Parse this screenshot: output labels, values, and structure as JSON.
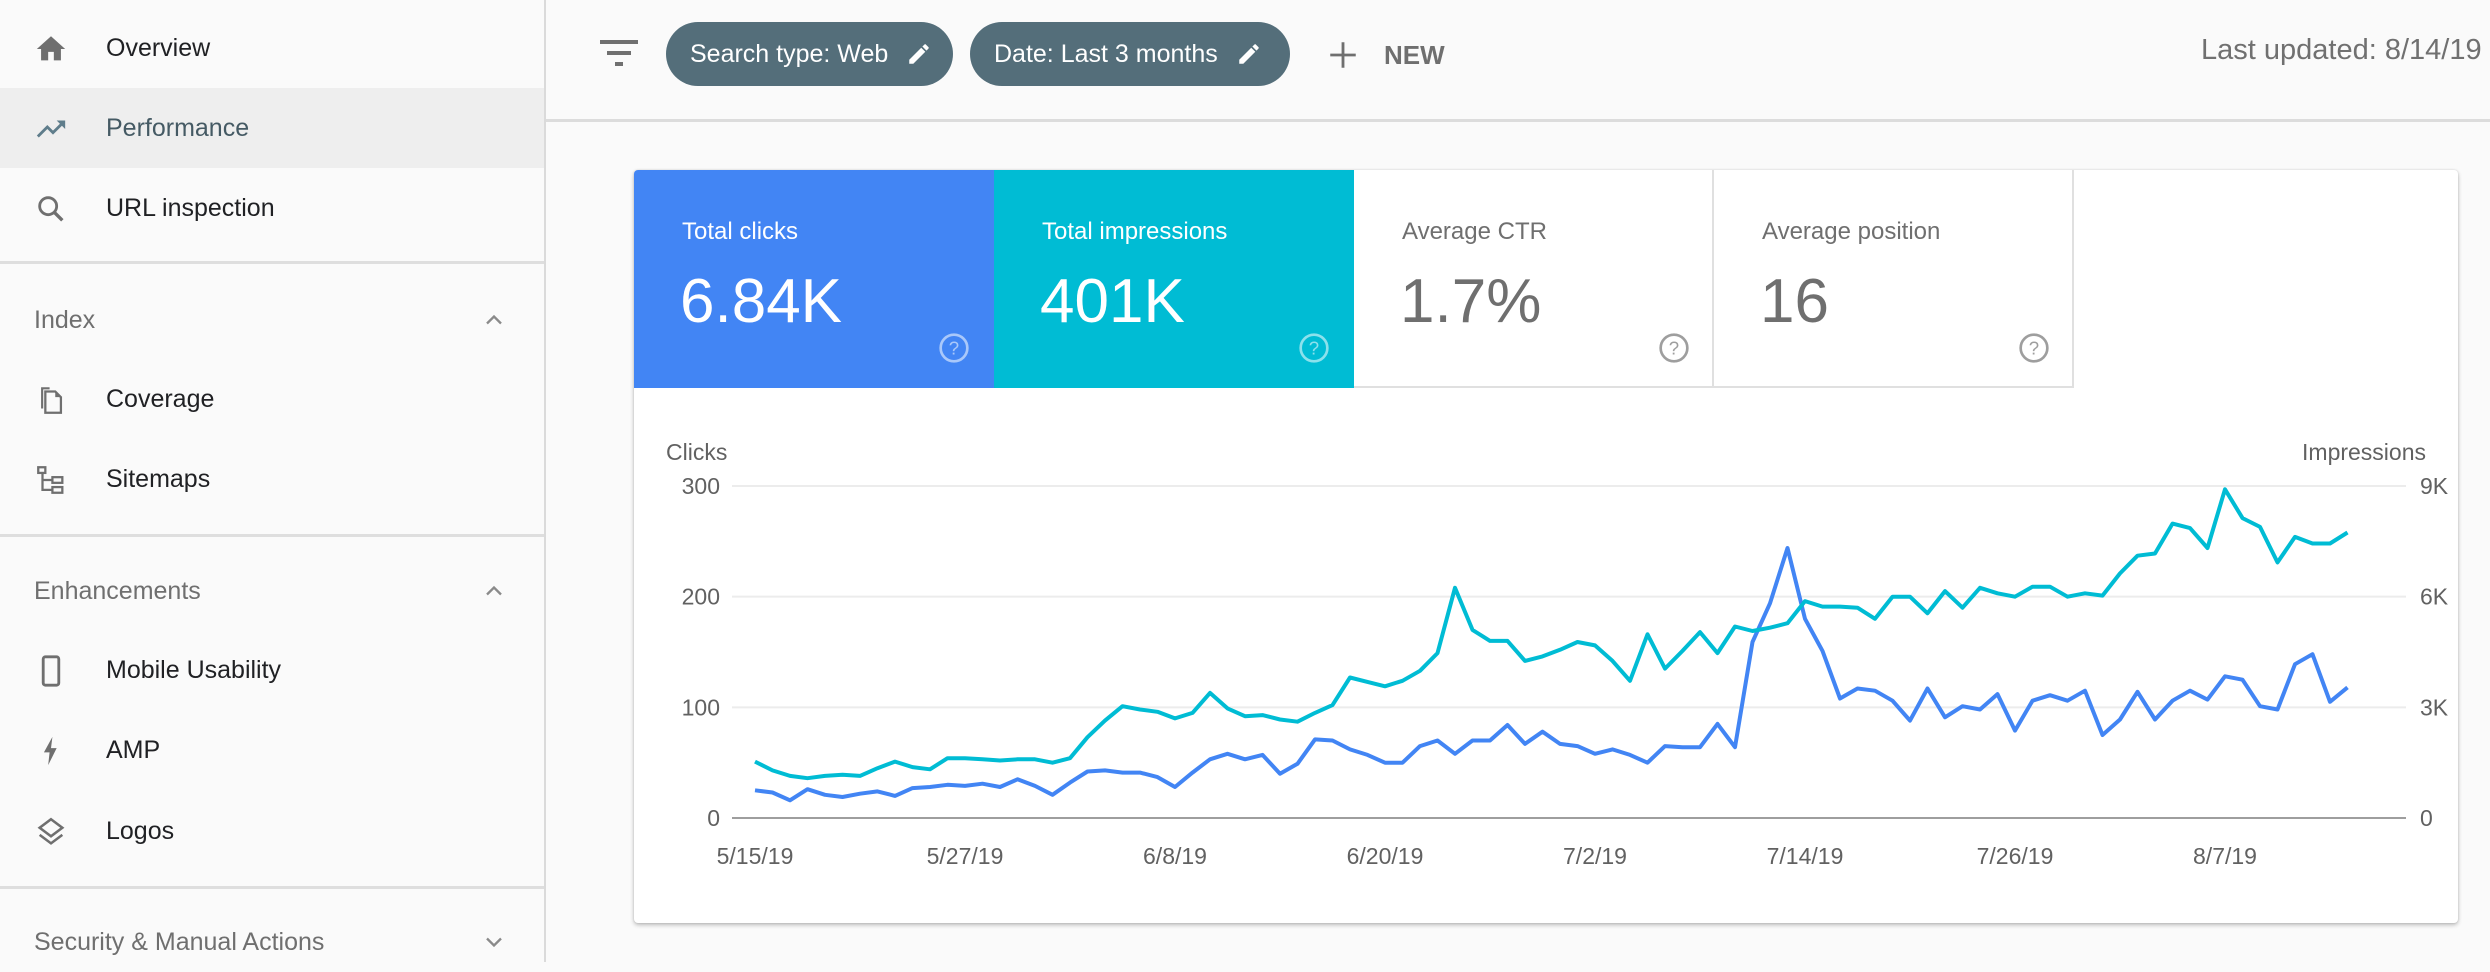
{
  "sidebar": {
    "top_items": [
      {
        "label": "Overview",
        "icon": "home-icon",
        "active": false
      },
      {
        "label": "Performance",
        "icon": "trending-up-icon",
        "active": true
      },
      {
        "label": "URL inspection",
        "icon": "search-icon",
        "active": false
      }
    ],
    "sections": [
      {
        "label": "Index",
        "expanded": true,
        "items": [
          {
            "label": "Coverage",
            "icon": "file-copy-icon"
          },
          {
            "label": "Sitemaps",
            "icon": "sitemap-icon"
          }
        ]
      },
      {
        "label": "Enhancements",
        "expanded": true,
        "items": [
          {
            "label": "Mobile Usability",
            "icon": "smartphone-icon"
          },
          {
            "label": "AMP",
            "icon": "bolt-icon"
          },
          {
            "label": "Logos",
            "icon": "layers-icon"
          }
        ]
      },
      {
        "label": "Security & Manual Actions",
        "expanded": false,
        "items": []
      }
    ]
  },
  "toolbar": {
    "filters": [
      {
        "label": "Search type: Web"
      },
      {
        "label": "Date: Last 3 months"
      }
    ],
    "new_label": "NEW",
    "last_updated": "Last updated: 8/14/19"
  },
  "metrics": [
    {
      "label": "Total clicks",
      "value": "6.84K",
      "selected": true,
      "color": "#4285f4"
    },
    {
      "label": "Total impressions",
      "value": "401K",
      "selected": true,
      "color": "#00bcd4"
    },
    {
      "label": "Average CTR",
      "value": "1.7%",
      "selected": false
    },
    {
      "label": "Average position",
      "value": "16",
      "selected": false
    }
  ],
  "chart_data": {
    "type": "line",
    "title": "",
    "ylabel_left": "Clicks",
    "ylabel_right": "Impressions",
    "ylim_left": [
      0,
      300
    ],
    "ylim_right": [
      0,
      9000
    ],
    "yticks_left": [
      "0",
      "100",
      "200",
      "300"
    ],
    "yticks_right": [
      "0",
      "3K",
      "6K",
      "9K"
    ],
    "grid": true,
    "x_start": "5/15/19",
    "x_tick_labels": [
      {
        "label": "5/15/19",
        "index": 0
      },
      {
        "label": "5/27/19",
        "index": 12
      },
      {
        "label": "6/8/19",
        "index": 24
      },
      {
        "label": "6/20/19",
        "index": 36
      },
      {
        "label": "7/2/19",
        "index": 48
      },
      {
        "label": "7/14/19",
        "index": 60
      },
      {
        "label": "7/26/19",
        "index": 72
      },
      {
        "label": "8/7/19",
        "index": 84
      }
    ],
    "series": [
      {
        "name": "Clicks",
        "axis": "left",
        "color": "#4285f4",
        "values": [
          25,
          23,
          16,
          26,
          21,
          19,
          22,
          24,
          20,
          27,
          28,
          30,
          29,
          31,
          28,
          35,
          29,
          21,
          32,
          42,
          43,
          41,
          41,
          37,
          28,
          41,
          53,
          58,
          53,
          57,
          40,
          49,
          71,
          70,
          62,
          57,
          50,
          50,
          65,
          70,
          58,
          70,
          70,
          84,
          67,
          78,
          67,
          65,
          58,
          62,
          57,
          50,
          65,
          64,
          64,
          85,
          64,
          159,
          194,
          244,
          180,
          151,
          108,
          117,
          115,
          106,
          88,
          117,
          91,
          101,
          98,
          112,
          79,
          106,
          111,
          106,
          115,
          75,
          89,
          114,
          89,
          106,
          115,
          107,
          128,
          125,
          101,
          98,
          139,
          148,
          105,
          118
        ]
      },
      {
        "name": "Impressions",
        "axis": "right",
        "color": "#00bcd4",
        "values": [
          1530,
          1290,
          1140,
          1080,
          1140,
          1170,
          1140,
          1350,
          1530,
          1380,
          1320,
          1620,
          1620,
          1590,
          1560,
          1590,
          1590,
          1500,
          1620,
          2190,
          2640,
          3030,
          2940,
          2880,
          2700,
          2850,
          3390,
          2970,
          2760,
          2790,
          2670,
          2610,
          2850,
          3060,
          3810,
          3690,
          3570,
          3720,
          3990,
          4470,
          6240,
          5100,
          4800,
          4800,
          4260,
          4380,
          4560,
          4770,
          4680,
          4260,
          3720,
          4980,
          4050,
          4530,
          5040,
          4470,
          5190,
          5070,
          5160,
          5280,
          5880,
          5730,
          5730,
          5700,
          5400,
          6000,
          6000,
          5550,
          6150,
          5700,
          6240,
          6090,
          6000,
          6270,
          6270,
          6000,
          6090,
          6030,
          6630,
          7110,
          7170,
          7980,
          7860,
          7320,
          8910,
          8130,
          7890,
          6930,
          7620,
          7440,
          7440,
          7740
        ]
      }
    ]
  }
}
